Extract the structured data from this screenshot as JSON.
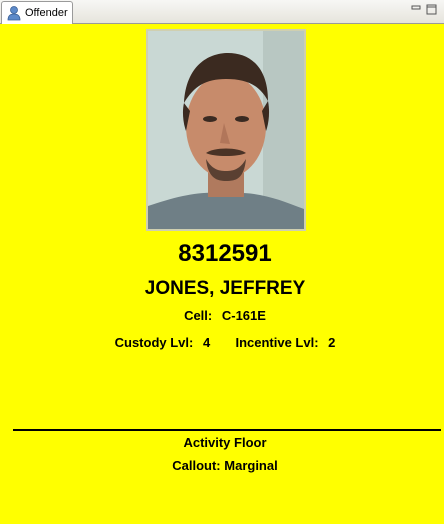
{
  "tab": {
    "label": "Offender",
    "icon": "person-icon"
  },
  "window_controls": {
    "minimize_icon": "minimize-icon",
    "maximize_icon": "maximize-icon"
  },
  "offender": {
    "id": "8312591",
    "name": "JONES, JEFFREY",
    "cell_label": "Cell:",
    "cell_value": "C-161E",
    "custody_label": "Custody Lvl:",
    "custody_value": "4",
    "incentive_label": "Incentive Lvl:",
    "incentive_value": "2"
  },
  "activity": {
    "location": "Activity Floor",
    "callout_label": "Callout:",
    "callout_value": "Marginal"
  },
  "colors": {
    "panel_background": "#ffff00",
    "text": "#000000"
  }
}
